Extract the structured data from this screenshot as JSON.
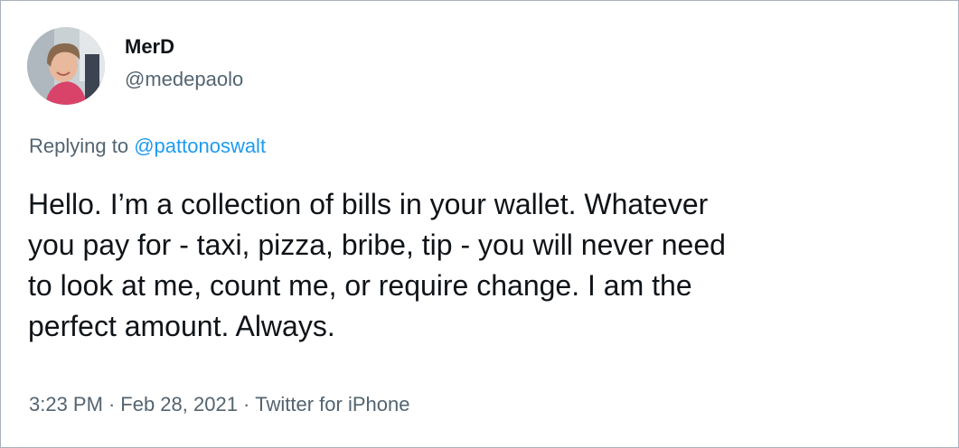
{
  "author": {
    "display_name": "MerD",
    "handle": "@medepaolo"
  },
  "reply": {
    "prefix": "Replying to",
    "to_handle": "@pattonoswalt"
  },
  "tweet": {
    "text": "Hello. I’m a collection of bills in your wallet. Whatever\nyou pay for - taxi, pizza, bribe, tip - you will never need\nto look at me, count me, or require change. I am the\nperfect amount. Always."
  },
  "meta": {
    "time": "3:23 PM",
    "separator": "·",
    "date": "Feb 28, 2021",
    "client": "Twitter for iPhone"
  },
  "colors": {
    "text_primary": "#0f1419",
    "text_secondary": "#536471",
    "link": "#1d9bf0",
    "border": "#a9b1b8"
  }
}
